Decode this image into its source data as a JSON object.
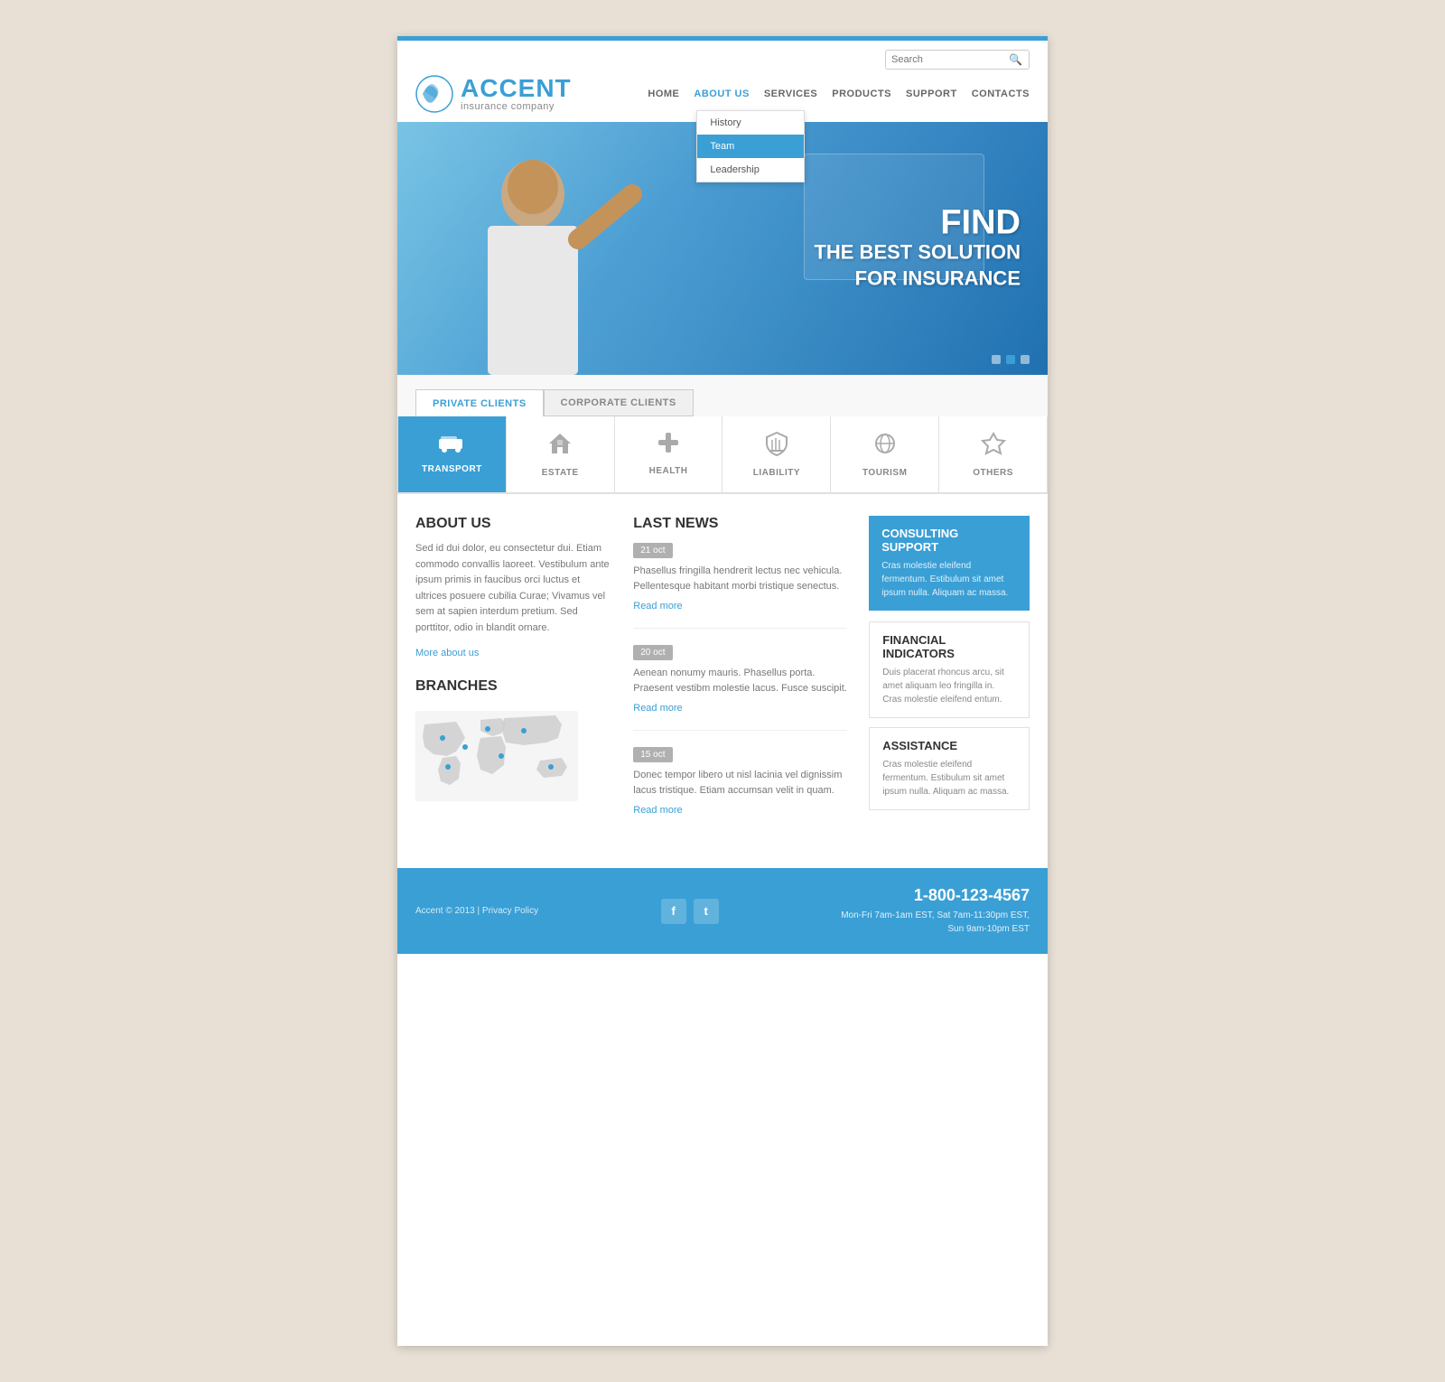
{
  "site": {
    "logo_accent": "ACCENT",
    "logo_subtitle": "insurance company",
    "top_bar_color": "#3a9fd5"
  },
  "header": {
    "search_placeholder": "Search",
    "nav": [
      {
        "label": "HOME",
        "id": "home",
        "active": false
      },
      {
        "label": "ABOUT US",
        "id": "about-us",
        "active": true
      },
      {
        "label": "SERVICES",
        "id": "services",
        "active": false
      },
      {
        "label": "PRODUCTS",
        "id": "products",
        "active": false
      },
      {
        "label": "SUPPORT",
        "id": "support",
        "active": false
      },
      {
        "label": "CONTACTS",
        "id": "contacts",
        "active": false
      }
    ],
    "dropdown": {
      "items": [
        {
          "label": "History",
          "selected": false
        },
        {
          "label": "Team",
          "selected": true
        },
        {
          "label": "Leadership",
          "selected": false
        }
      ]
    }
  },
  "hero": {
    "line1": "FIND",
    "line2": "THE BEST SOLUTION",
    "line3": "FOR INSURANCE",
    "dots": [
      false,
      true,
      false
    ]
  },
  "tabs": {
    "private_clients": "PRIVATE CLIENTS",
    "corporate_clients": "CORPORATE CLIENTS",
    "active": "private"
  },
  "insurance_categories": [
    {
      "label": "TRANSPORT",
      "icon": "🚗",
      "active": true
    },
    {
      "label": "ESTATE",
      "icon": "🏠",
      "active": false
    },
    {
      "label": "HEALTH",
      "icon": "✚",
      "active": false
    },
    {
      "label": "LIABILITY",
      "icon": "⚖",
      "active": false
    },
    {
      "label": "TOURISM",
      "icon": "✈",
      "active": false
    },
    {
      "label": "OTHERS",
      "icon": "✈",
      "active": false
    }
  ],
  "about_us": {
    "title": "ABOUT US",
    "text": "Sed id dui dolor, eu consectetur dui. Etiam commodo convallis laoreet. Vestibulum ante ipsum primis in faucibus orci luctus et ultrices posuere cubilia Curae; Vivamus vel sem at sapien interdum pretium. Sed porttitor, odio in blandit ornare.",
    "link": "More about us"
  },
  "branches": {
    "title": "BRANCHES"
  },
  "last_news": {
    "title": "LAST NEWS",
    "items": [
      {
        "date": "21 oct",
        "text": "Phasellus fringilla hendrerit lectus nec vehicula. Pellentesque habitant morbi tristique senectus.",
        "link": "Read more"
      },
      {
        "date": "20 oct",
        "text": "Aenean nonumy mauris. Phasellus porta. Praesent vestibm molestie lacus. Fusce suscipit.",
        "link": "Read more"
      },
      {
        "date": "15 oct",
        "text": "Donec tempor libero ut nisl lacinia vel dignissim lacus tristique. Etiam accumsan velit in quam.",
        "link": "Read more"
      }
    ]
  },
  "consulting": {
    "title": "CONSULTING SUPPORT",
    "text": "Cras molestie eleifend fermentum. Estibulum sit amet ipsum nulla. Aliquam ac massa."
  },
  "financial": {
    "title": "FINANCIAL INDICATORS",
    "text": "Duis placerat rhoncus arcu, sit amet aliquam leo fringilla in. Cras molestie eleifend entum."
  },
  "assistance": {
    "title": "ASSISTANCE",
    "text": "Cras molestie eleifend fermentum. Estibulum sit amet ipsum nulla.  Aliquam ac massa."
  },
  "footer": {
    "copyright": "Accent © 2013 | Privacy Policy",
    "social": [
      "f",
      "t"
    ],
    "phone": "1-800-123-4567",
    "hours_line1": "Mon-Fri 7am-1am EST, Sat 7am-11:30pm EST,",
    "hours_line2": "Sun 9am-10pm EST"
  }
}
